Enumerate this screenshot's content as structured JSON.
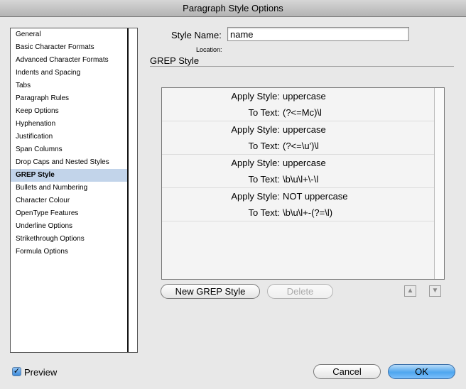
{
  "window": {
    "title": "Paragraph Style Options"
  },
  "sidebar": {
    "selected_index": 12,
    "items": [
      "General",
      "Basic Character Formats",
      "Advanced Character Formats",
      "Indents and Spacing",
      "Tabs",
      "Paragraph Rules",
      "Keep Options",
      "Hyphenation",
      "Justification",
      "Span Columns",
      "Drop Caps and Nested Styles",
      "GREP Style",
      "Bullets and Numbering",
      "Character Colour",
      "OpenType Features",
      "Underline Options",
      "Strikethrough Options",
      "Formula Options"
    ]
  },
  "style_name": {
    "label": "Style Name:",
    "value": "name"
  },
  "location": {
    "label": "Location:"
  },
  "section": {
    "title": "GREP Style"
  },
  "grep_styles": [
    {
      "apply_label": "Apply Style:",
      "apply_value": "uppercase",
      "text_label": "To Text:",
      "text_value": "(?<=Mc)\\l"
    },
    {
      "apply_label": "Apply Style:",
      "apply_value": "uppercase",
      "text_label": "To Text:",
      "text_value": "(?<=\\u')\\l"
    },
    {
      "apply_label": "Apply Style:",
      "apply_value": "uppercase",
      "text_label": "To Text:",
      "text_value": "\\b\\u\\l+\\-\\l"
    },
    {
      "apply_label": "Apply Style:",
      "apply_value": "NOT uppercase",
      "text_label": "To Text:",
      "text_value": "\\b\\u\\l+-(?=\\l)"
    }
  ],
  "buttons": {
    "new_grep_style": "New GREP Style",
    "delete": "Delete",
    "cancel": "Cancel",
    "ok": "OK"
  },
  "icons": {
    "move_up": "triangle-up-icon",
    "move_down": "triangle-down-icon",
    "checkmark": "checkmark-icon"
  },
  "preview": {
    "label": "Preview",
    "checked": true
  },
  "colors": {
    "selection": "#c2d4ea",
    "default_button": "#4ea6ef"
  }
}
